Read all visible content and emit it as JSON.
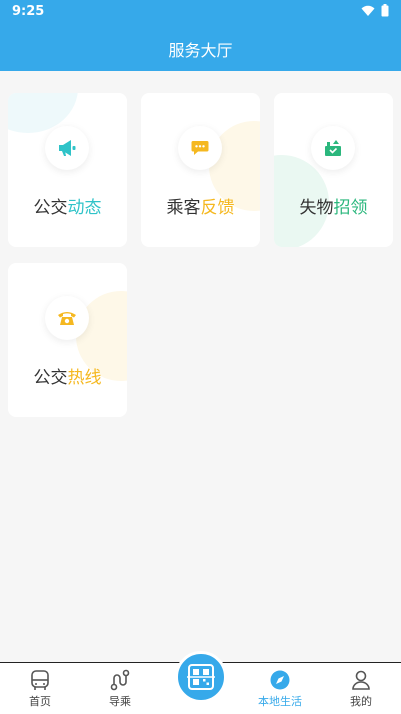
{
  "status_bar": {
    "time": "9:25"
  },
  "header": {
    "title": "服务大厅"
  },
  "cards": [
    {
      "prefix": "公交",
      "accent": "动态",
      "accent_color": "#2fc3c8",
      "icon": "megaphone-icon"
    },
    {
      "prefix": "乘客",
      "accent": "反馈",
      "accent_color": "#f5b820",
      "icon": "chat-bubble-icon"
    },
    {
      "prefix": "失物",
      "accent": "招领",
      "accent_color": "#2bb77d",
      "icon": "lost-found-box-icon"
    },
    {
      "prefix": "公交",
      "accent": "热线",
      "accent_color": "#f5b820",
      "icon": "telephone-icon"
    }
  ],
  "nav": {
    "home": "首页",
    "guide": "导乘",
    "local": "本地生活",
    "mine": "我的",
    "active_color": "#36a9ea"
  }
}
